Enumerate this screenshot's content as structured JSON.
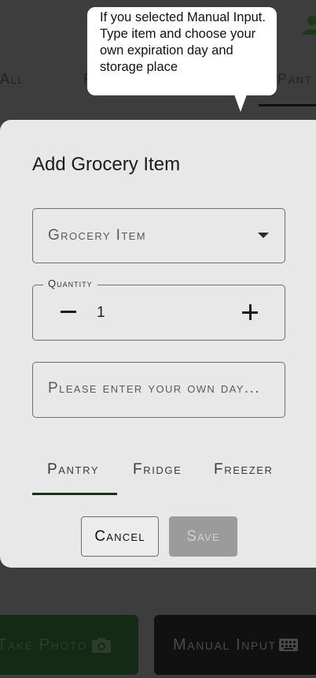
{
  "background": {
    "tabs": {
      "all": "All",
      "partial": "F",
      "pantry": "Pant"
    },
    "take_photo_label": "Take Photo",
    "manual_input_label": "Manual Input"
  },
  "tooltip": {
    "text": "If you selected Manual Input. Type item and choose your own expiration day and storage place"
  },
  "dialog": {
    "title": "Add Grocery Item",
    "grocery_select_label": "Grocery Item",
    "quantity_label": "Quantity",
    "quantity_value": "1",
    "day_placeholder": "Please enter your own day...",
    "storage_tabs": [
      "Pantry",
      "Fridge",
      "Freezer"
    ],
    "cancel_label": "Cancel",
    "save_label": "Save"
  },
  "colors": {
    "dialog_bg": "#e8e8e8",
    "tab_indicator": "#1e2e1e",
    "save_disabled": "#9b9b9b"
  },
  "icons": [
    "user-icon",
    "camera-icon",
    "keyboard-icon",
    "dropdown-caret-icon",
    "minus-icon",
    "plus-icon"
  ]
}
